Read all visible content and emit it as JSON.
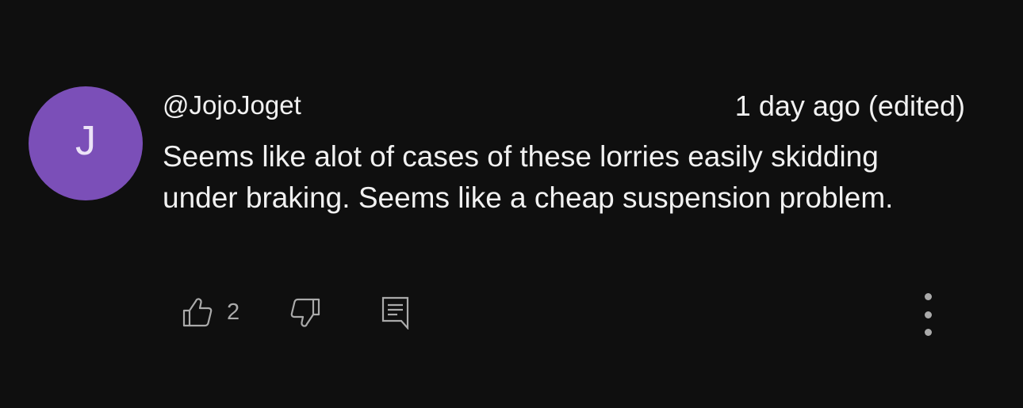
{
  "comment": {
    "avatar_letter": "J",
    "avatar_color": "#7b4fb8",
    "author": "@JojoJoget",
    "timestamp": "1 day ago (edited)",
    "text": "Seems like alot of cases of these lorries easily skidding under braking. Seems like a cheap suspension problem."
  },
  "actions": {
    "like_icon": "thumbs-up-icon",
    "like_count": "2",
    "dislike_icon": "thumbs-down-icon",
    "reply_icon": "reply-comment-icon",
    "menu_icon": "more-vertical-icon"
  },
  "colors": {
    "background": "#0f0f0f",
    "text": "#f1f1f1",
    "secondary": "#aaaaaa"
  }
}
